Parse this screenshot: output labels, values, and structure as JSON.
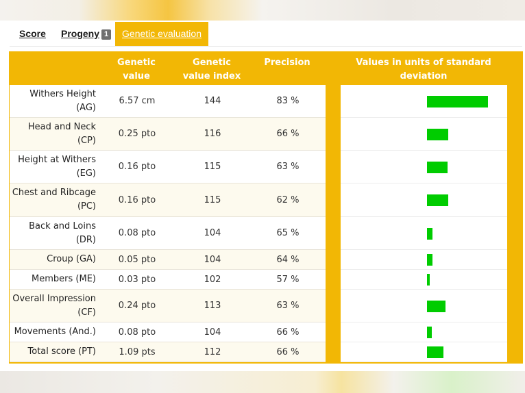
{
  "tabs": [
    {
      "label": "Score"
    },
    {
      "label": "Progeny",
      "badge": "1"
    },
    {
      "label": "Genetic evaluation",
      "active": true
    }
  ],
  "headers": {
    "genetic_value": "Genetic value",
    "genetic_value_index": "Genetic value index",
    "precision": "Precision",
    "std_dev": "Values in units of standard deviation"
  },
  "colors": {
    "accent": "#f2b705",
    "bar": "#00cc00"
  },
  "rows": [
    {
      "name": "Withers Height (AG)",
      "value": "6.57 cm",
      "index": "144",
      "precision": "83 %",
      "sd": 1.77
    },
    {
      "name": "Head and Neck (CP)",
      "value": "0.25 pto",
      "index": "116",
      "precision": "66 %",
      "sd": 0.62
    },
    {
      "name": "Height at Withers (EG)",
      "value": "0.16 pto",
      "index": "115",
      "precision": "63 %",
      "sd": 0.6
    },
    {
      "name": "Chest and Ribcage (PC)",
      "value": "0.16 pto",
      "index": "115",
      "precision": "62 %",
      "sd": 0.62
    },
    {
      "name": "Back and Loins (DR)",
      "value": "0.08 pto",
      "index": "104",
      "precision": "65 %",
      "sd": 0.16
    },
    {
      "name": "Croup (GA)",
      "value": "0.05 pto",
      "index": "104",
      "precision": "64 %",
      "sd": 0.16
    },
    {
      "name": "Members (ME)",
      "value": "0.03 pto",
      "index": "102",
      "precision": "57 %",
      "sd": 0.08
    },
    {
      "name": "Overall Impression (CF)",
      "value": "0.24 pto",
      "index": "113",
      "precision": "63 %",
      "sd": 0.54
    },
    {
      "name": "Movements (And.)",
      "value": "0.08 pto",
      "index": "104",
      "precision": "66 %",
      "sd": 0.14
    },
    {
      "name": "Total score (PT)",
      "value": "1.09 pts",
      "index": "112",
      "precision": "66 %",
      "sd": 0.48
    }
  ]
}
